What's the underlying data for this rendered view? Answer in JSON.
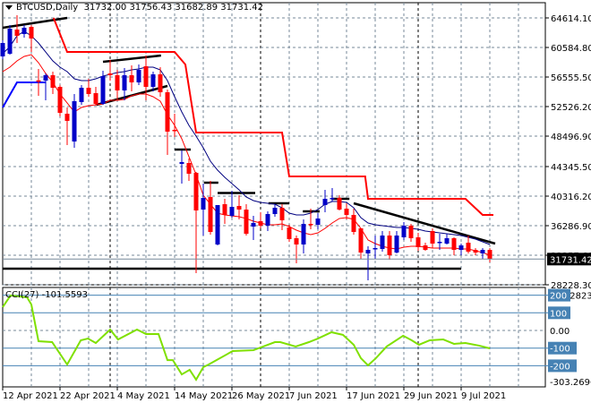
{
  "header": {
    "symbol": "BTCUSD,Daily",
    "open": "31732.00",
    "high": "31756.43",
    "low": "31682.89",
    "close": "31731.42"
  },
  "cci_label": "CCI(27) -101.5593",
  "current_price_label": "31731.42",
  "colors": {
    "up": "#0000C8",
    "down": "#FF0000",
    "ma_blue": "#000080",
    "ma_red": "#FF0000",
    "step_red": "#FF0000",
    "step_blue": "#0000FF",
    "cci": "#7FE000",
    "level": "#4682B4",
    "grid": "#778899",
    "trend": "#000000"
  },
  "chart_data": [
    {
      "type": "candlestick",
      "title": "BTCUSD,Daily",
      "y_axis_labels": [
        "64614.10",
        "60584.80",
        "56555.50",
        "52526.20",
        "48496.90",
        "44345.50",
        "40316.20",
        "36286.90",
        "32257.60",
        "28228.30"
      ],
      "y_axis_values": [
        64614.1,
        60584.8,
        56555.5,
        52526.2,
        48496.9,
        44345.5,
        40316.2,
        36286.9,
        32257.6,
        28228.3
      ],
      "ylim": [
        28228.3,
        66500
      ],
      "x_labels": [
        {
          "bar": 0,
          "label": "12 Apr 2021"
        },
        {
          "bar": 8,
          "label": "22 Apr 2021"
        },
        {
          "bar": 16,
          "label": "4 May 2021"
        },
        {
          "bar": 24,
          "label": "14 May 2021"
        },
        {
          "bar": 32,
          "label": "26 May 2021"
        },
        {
          "bar": 40,
          "label": "7 Jun 2021"
        },
        {
          "bar": 48,
          "label": "17 Jun 2021"
        },
        {
          "bar": 56,
          "label": "29 Jun 2021"
        },
        {
          "bar": 64,
          "label": "9 Jul 2021"
        }
      ],
      "month_separators": [
        15,
        36,
        58
      ],
      "ohlc": [
        [
          59364,
          61562,
          58997,
          61195
        ],
        [
          59730,
          63637,
          59600,
          63149
        ],
        [
          63027,
          64980,
          61195,
          62172
        ],
        [
          62416,
          63637,
          61928,
          63271
        ],
        [
          63393,
          63637,
          59974,
          61806
        ],
        [
          56100,
          57654,
          53991,
          56030
        ],
        [
          56067,
          57044,
          53381,
          56800
        ],
        [
          56800,
          57288,
          54236,
          55090
        ],
        [
          55212,
          55456,
          51183,
          51671
        ],
        [
          51549,
          52404,
          47276,
          50572
        ],
        [
          47764,
          54236,
          46910,
          53259
        ],
        [
          53137,
          55456,
          52770,
          55090
        ],
        [
          55090,
          56311,
          53869,
          54236
        ],
        [
          54358,
          55212,
          52648,
          52892
        ],
        [
          52892,
          57410,
          52770,
          56678
        ],
        [
          57044,
          58875,
          56067,
          56800
        ],
        [
          56800,
          57532,
          53381,
          54724
        ],
        [
          54724,
          57776,
          53381,
          56800
        ],
        [
          56800,
          58143,
          54602,
          55823
        ],
        [
          55823,
          58265,
          55456,
          57532
        ],
        [
          58021,
          59486,
          53381,
          55212
        ],
        [
          55212,
          57288,
          54602,
          56922
        ],
        [
          56922,
          57898,
          53869,
          54480
        ],
        [
          54480,
          54846,
          45933,
          49107
        ],
        [
          49351,
          51549,
          48375,
          49229
        ],
        [
          44712,
          46543,
          42026,
          44956
        ],
        [
          44834,
          45445,
          42392,
          43369
        ],
        [
          43491,
          43613,
          29816,
          38362
        ],
        [
          38483,
          42026,
          34944,
          40072
        ],
        [
          40194,
          42392,
          35066,
          35432
        ],
        [
          33723,
          39096,
          33600,
          39096
        ],
        [
          39217,
          39950,
          36531,
          37752
        ],
        [
          37630,
          41049,
          37386,
          38851
        ],
        [
          38973,
          40438,
          37142,
          38485
        ],
        [
          38485,
          39217,
          34944,
          35188
        ],
        [
          36165,
          37630,
          34333,
          36653
        ],
        [
          36897,
          38118,
          35921,
          36287
        ],
        [
          36287,
          38241,
          35555,
          37874
        ],
        [
          37874,
          39217,
          37508,
          38729
        ],
        [
          38729,
          39217,
          35677,
          37020
        ],
        [
          36043,
          36409,
          34089,
          34455
        ],
        [
          34577,
          34944,
          31159,
          33723
        ],
        [
          33723,
          37142,
          32502,
          36531
        ],
        [
          36531,
          38607,
          35799,
          36409
        ],
        [
          36409,
          37996,
          35799,
          37264
        ],
        [
          39096,
          41171,
          38119,
          39950
        ],
        [
          39950,
          41415,
          39584,
          40072
        ],
        [
          40072,
          40438,
          38362,
          38485
        ],
        [
          38607,
          39340,
          37142,
          37752
        ],
        [
          37752,
          38607,
          35066,
          35432
        ],
        [
          35925,
          35925,
          31769,
          32624
        ],
        [
          32502,
          33479,
          28839,
          32990
        ],
        [
          33113,
          34944,
          31769,
          33235
        ],
        [
          33113,
          35555,
          32746,
          34944
        ],
        [
          34944,
          35555,
          31647,
          32258
        ],
        [
          32624,
          35555,
          32502,
          34944
        ],
        [
          34700,
          36780,
          34333,
          36287
        ],
        [
          36287,
          36531,
          34089,
          34577
        ],
        [
          34700,
          35310,
          32868,
          33357
        ],
        [
          33601,
          33967,
          32868,
          32990
        ],
        [
          35555,
          35921,
          33235,
          33845
        ],
        [
          33967,
          35188,
          32990,
          34089
        ],
        [
          33845,
          35188,
          33723,
          34577
        ],
        [
          34577,
          34700,
          32258,
          32990
        ],
        [
          32990,
          33845,
          32258,
          33601
        ],
        [
          33967,
          34944,
          32502,
          32746
        ],
        [
          32990,
          33235,
          32258,
          32624
        ],
        [
          32502,
          33235,
          31769,
          32990
        ],
        [
          32990,
          33235,
          31300,
          31731
        ]
      ],
      "ma_blue": [
        59730,
        60707,
        62172,
        62783,
        62172,
        61195,
        59974,
        58753,
        57898,
        57288,
        56311,
        56067,
        56067,
        56311,
        56678,
        56922,
        57166,
        57288,
        57532,
        57654,
        57898,
        57898,
        57532,
        56067,
        53869,
        51793,
        49962,
        48497,
        46910,
        45078,
        43857,
        42880,
        42026,
        41171,
        40194,
        39706,
        39461,
        39340,
        39217,
        38729,
        37997,
        37752,
        37752,
        37997,
        38485,
        39217,
        39584,
        39584,
        39461,
        38729,
        37386,
        36653,
        36409,
        36287,
        36165,
        36043,
        36043,
        35921,
        35799,
        35555,
        35432,
        35310,
        35188,
        35066,
        34944,
        34700,
        34455,
        34089,
        33723
      ],
      "ma_red": [
        57288,
        57898,
        58753,
        59364,
        59608,
        58509,
        57044,
        55823,
        54236,
        53015,
        51793,
        52404,
        52648,
        52770,
        52892,
        53381,
        53381,
        53503,
        53991,
        54236,
        54236,
        53869,
        53259,
        51427,
        49962,
        48131,
        45689,
        43247,
        40438,
        39217,
        37997,
        37752,
        37630,
        37508,
        37264,
        36897,
        36653,
        36409,
        36409,
        36531,
        36165,
        35677,
        35310,
        35066,
        35310,
        35921,
        36653,
        37264,
        37386,
        37142,
        35921,
        34333,
        33845,
        33479,
        33235,
        33113,
        33357,
        33479,
        33479,
        33357,
        33235,
        33235,
        33235,
        33235,
        33113,
        33113,
        32868,
        32624,
        32258
      ],
      "step_red": [
        [
          7.1,
          64614
        ],
        [
          9,
          59974
        ],
        [
          24,
          59974
        ],
        [
          25.5,
          58265
        ],
        [
          27,
          48985
        ],
        [
          39,
          48985
        ],
        [
          40,
          43003
        ],
        [
          50.6,
          43003
        ],
        [
          51,
          39950
        ],
        [
          64.6,
          39950
        ],
        [
          67,
          37752
        ],
        [
          68.5,
          37752
        ]
      ],
      "step_blue": [
        [
          0,
          52404
        ],
        [
          2,
          55823
        ],
        [
          6,
          55823
        ]
      ],
      "trendlines": [
        [
          [
            0,
            63271
          ],
          [
            9,
            64614
          ]
        ],
        [
          [
            14,
            58631
          ],
          [
            22.1,
            59486
          ]
        ],
        [
          [
            13.1,
            52770
          ],
          [
            23,
            55334
          ]
        ],
        [
          [
            24,
            46665
          ],
          [
            26.25,
            46665
          ]
        ],
        [
          [
            28.1,
            42148
          ],
          [
            30.1,
            42148
          ]
        ],
        [
          [
            30,
            40736
          ],
          [
            35.25,
            40736
          ]
        ],
        [
          [
            37.1,
            39340
          ],
          [
            40,
            39340
          ]
        ],
        [
          [
            41.9,
            38241
          ],
          [
            44.25,
            38241
          ]
        ],
        [
          [
            45.9,
            39950
          ],
          [
            48.4,
            39950
          ]
        ],
        [
          [
            49,
            39340
          ],
          [
            68.75,
            33845
          ]
        ],
        [
          [
            0,
            30426
          ],
          [
            64,
            30426
          ]
        ]
      ],
      "current_price": 31731.42
    },
    {
      "type": "line",
      "title": "CCI(27)",
      "last_value": -101.5593,
      "ylim": [
        -303.2696,
        229.2823
      ],
      "y_axis_labels": [
        "229.2823",
        "200",
        "100",
        "0.00",
        "-100",
        "-200",
        "-303.2696"
      ],
      "levels": [
        200,
        100,
        -100,
        -200
      ],
      "points": [
        [
          0,
          132
        ],
        [
          1.1,
          198
        ],
        [
          3.4,
          188
        ],
        [
          4,
          147
        ],
        [
          5,
          -61
        ],
        [
          6.9,
          -66
        ],
        [
          9,
          -193
        ],
        [
          10.9,
          -56
        ],
        [
          11.9,
          -46
        ],
        [
          13,
          -71
        ],
        [
          15,
          5
        ],
        [
          16.1,
          -51
        ],
        [
          18.75,
          5
        ],
        [
          20,
          -20
        ],
        [
          21.75,
          -20
        ],
        [
          23,
          -168
        ],
        [
          23.75,
          -168
        ],
        [
          25,
          -249
        ],
        [
          26.1,
          -223
        ],
        [
          27,
          -279
        ],
        [
          28,
          -208
        ],
        [
          28.75,
          -193
        ],
        [
          32.1,
          -117
        ],
        [
          35,
          -112
        ],
        [
          38,
          -66
        ],
        [
          38.75,
          -66
        ],
        [
          40.9,
          -91
        ],
        [
          42.75,
          -66
        ],
        [
          44,
          -46
        ],
        [
          45.9,
          -10
        ],
        [
          47.5,
          -25
        ],
        [
          49,
          -81
        ],
        [
          50,
          -157
        ],
        [
          51,
          -198
        ],
        [
          52.1,
          -157
        ],
        [
          53.6,
          -91
        ],
        [
          55.9,
          -30
        ],
        [
          57.1,
          -56
        ],
        [
          58.1,
          -81
        ],
        [
          59.6,
          -56
        ],
        [
          61.5,
          -51
        ],
        [
          63,
          -76
        ],
        [
          64.6,
          -71
        ],
        [
          66.5,
          -86
        ],
        [
          68,
          -101.56
        ]
      ]
    }
  ]
}
